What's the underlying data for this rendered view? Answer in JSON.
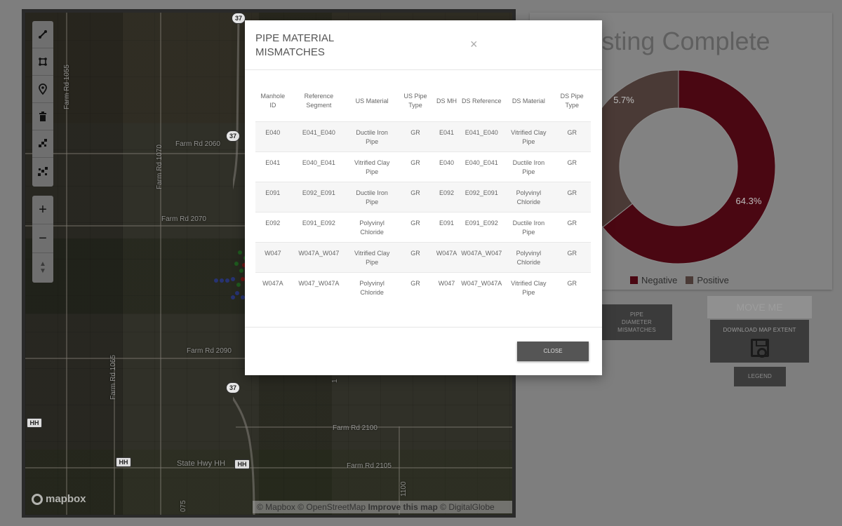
{
  "map": {
    "road_labels": {
      "farm_rd_1055": "Farm Rd 1055",
      "farm_rd_1070": "Farm Rd 1070",
      "farm_rd_2060": "Farm Rd 2060",
      "farm_rd_2070": "Farm Rd 2070",
      "farm_rd_2090": "Farm Rd 2090",
      "farm_rd_1065": "Farm Rd 1065",
      "farm_rd_2100": "Farm Rd 2100",
      "farm_rd_2105": "Farm Rd 2105",
      "state_hwy_hh": "State Hwy HH",
      "farm_rd_1100": "1100",
      "farm_rd_075": "075",
      "farm_rd_1_fragment": "1"
    },
    "shields": {
      "route_37": "37",
      "route_hh": "HH"
    },
    "mapbox_logo": "mapbox",
    "attribution": {
      "mapbox": "© Mapbox",
      "osm": "© OpenStreetMap",
      "improve": "Improve this map",
      "digitalglobe": "© DigitalGlobe"
    },
    "tools": [
      "line-tool-icon",
      "polygon-tool-icon",
      "marker-tool-icon",
      "trash-icon",
      "combine-icon",
      "uncombine-icon"
    ],
    "zoom": {
      "in": "+",
      "out": "−",
      "compass": "▲\n▼"
    }
  },
  "dashboard": {
    "chart_title": "e Testing Complete",
    "move_button": "MOVE ME",
    "pipe_diameter_button": "PIPE\nDIAMETER\nMISMATCHES",
    "download_button": "DOWNLOAD MAP EXTENT",
    "legend_button": "LEGEND"
  },
  "chart_data": {
    "type": "pie",
    "title": "",
    "categories": [
      "Negative",
      "Positive"
    ],
    "values": [
      64.3,
      35.7
    ],
    "labels": [
      "64.3%",
      "5.7%"
    ],
    "colors": [
      "#4a0712",
      "#4a3a36"
    ]
  },
  "modal": {
    "title": "PIPE MATERIAL MISMATCHES",
    "close_icon": "×",
    "close_button": "CLOSE",
    "columns": [
      "Manhole ID",
      "Reference Segment",
      "US Material",
      "US Pipe Type",
      "DS MH",
      "DS Reference",
      "DS Material",
      "DS Pipe Type"
    ],
    "rows": [
      [
        "E040",
        "E041_E040",
        "Ductile Iron Pipe",
        "GR",
        "E041",
        "E041_E040",
        "Vitrified Clay Pipe",
        "GR"
      ],
      [
        "E041",
        "E040_E041",
        "Vitrified Clay Pipe",
        "GR",
        "E040",
        "E040_E041",
        "Ductile Iron Pipe",
        "GR"
      ],
      [
        "E091",
        "E092_E091",
        "Ductile Iron Pipe",
        "GR",
        "E092",
        "E092_E091",
        "Polyvinyl Chloride",
        "GR"
      ],
      [
        "E092",
        "E091_E092",
        "Polyvinyl Chloride",
        "GR",
        "E091",
        "E091_E092",
        "Ductile Iron Pipe",
        "GR"
      ],
      [
        "W047",
        "W047A_W047",
        "Vitrified Clay Pipe",
        "GR",
        "W047A",
        "W047A_W047",
        "Polyvinyl Chloride",
        "GR"
      ],
      [
        "W047A",
        "W047_W047A",
        "Polyvinyl Chloride",
        "GR",
        "W047",
        "W047_W047A",
        "Vitrified Clay Pipe",
        "GR"
      ]
    ]
  }
}
